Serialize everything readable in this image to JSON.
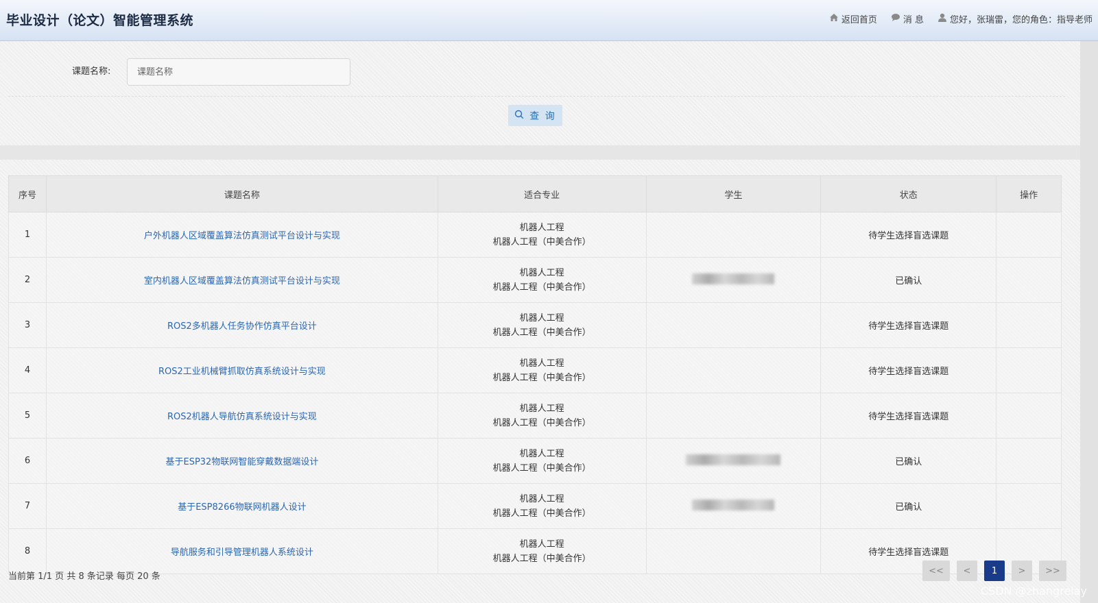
{
  "header": {
    "title": "毕业设计（论文）智能管理系统",
    "home": "返回首页",
    "messages": "消 息",
    "user": "您好，张瑞雷，您的角色：指导老师"
  },
  "search": {
    "label": "课题名称:",
    "placeholder": "课题名称",
    "button": "查 询"
  },
  "table": {
    "headers": [
      "序号",
      "课题名称",
      "适合专业",
      "学生",
      "状态",
      "操作"
    ],
    "rows": [
      {
        "no": "1",
        "title": "户外机器人区域覆盖算法仿真测试平台设计与实现",
        "major1": "机器人工程",
        "major2": "机器人工程（中美合作）",
        "status": "待学生选择盲选课题"
      },
      {
        "no": "2",
        "title": "室内机器人区域覆盖算法仿真测试平台设计与实现",
        "major1": "机器人工程",
        "major2": "机器人工程（中美合作）",
        "status": "已确认"
      },
      {
        "no": "3",
        "title": "ROS2多机器人任务协作仿真平台设计",
        "major1": "机器人工程",
        "major2": "机器人工程（中美合作）",
        "status": "待学生选择盲选课题"
      },
      {
        "no": "4",
        "title": "ROS2工业机械臂抓取仿真系统设计与实现",
        "major1": "机器人工程",
        "major2": "机器人工程（中美合作）",
        "status": "待学生选择盲选课题"
      },
      {
        "no": "5",
        "title": "ROS2机器人导航仿真系统设计与实现",
        "major1": "机器人工程",
        "major2": "机器人工程（中美合作）",
        "status": "待学生选择盲选课题"
      },
      {
        "no": "6",
        "title": "基于ESP32物联网智能穿戴数据端设计",
        "major1": "机器人工程",
        "major2": "机器人工程（中美合作）",
        "status": "已确认"
      },
      {
        "no": "7",
        "title": "基于ESP8266物联网机器人设计",
        "major1": "机器人工程",
        "major2": "机器人工程（中美合作）",
        "status": "已确认"
      },
      {
        "no": "8",
        "title": "导航服务和引导管理机器人系统设计",
        "major1": "机器人工程",
        "major2": "机器人工程（中美合作）",
        "status": "待学生选择盲选课题"
      }
    ]
  },
  "footer": {
    "page_info": "当前第 1/1 页 共 8 条记录 每页 20 条",
    "first": "<<",
    "prev": "<",
    "current": "1",
    "next": ">",
    "last": ">>"
  },
  "watermark": "CSDN @zhangrelay",
  "colors": {
    "link": "#2a66b4",
    "active_page": "#1a3b8a",
    "query_btn": "#d4e4f3"
  },
  "icons": {
    "home": "home-icon",
    "messages": "chat-icon",
    "user": "user-icon",
    "query": "search-icon"
  }
}
